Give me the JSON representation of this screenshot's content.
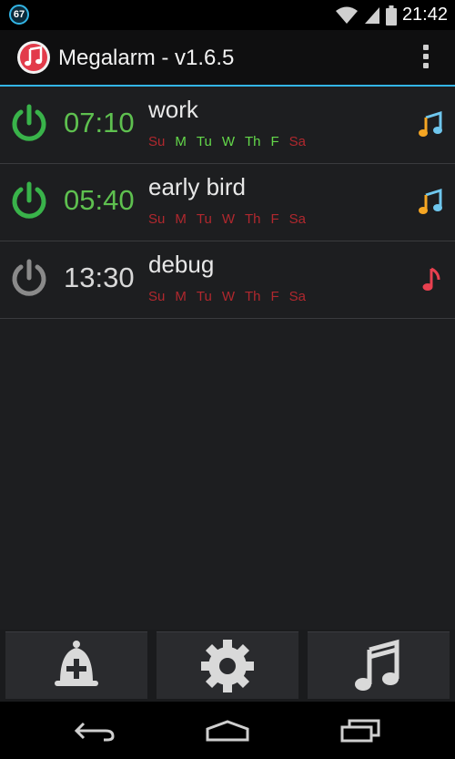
{
  "status_bar": {
    "notification_count": "67",
    "time": "21:42",
    "icons": [
      "wifi-icon",
      "cell-signal-icon",
      "battery-icon"
    ]
  },
  "action_bar": {
    "title": "Megalarm - v1.6.5",
    "app_icon": "music-note-app-icon",
    "overflow_icon": "overflow-menu-icon"
  },
  "alarms": [
    {
      "enabled": true,
      "time": "07:10",
      "name": "work",
      "days": [
        {
          "label": "Su",
          "active": false
        },
        {
          "label": "M",
          "active": true
        },
        {
          "label": "Tu",
          "active": true
        },
        {
          "label": "W",
          "active": true
        },
        {
          "label": "Th",
          "active": true
        },
        {
          "label": "F",
          "active": true
        },
        {
          "label": "Sa",
          "active": false
        }
      ],
      "sound_icon": "music-note-multicolor-icon"
    },
    {
      "enabled": true,
      "time": "05:40",
      "name": "early bird",
      "days": [
        {
          "label": "Su",
          "active": false
        },
        {
          "label": "M",
          "active": false
        },
        {
          "label": "Tu",
          "active": false
        },
        {
          "label": "W",
          "active": false
        },
        {
          "label": "Th",
          "active": false
        },
        {
          "label": "F",
          "active": false
        },
        {
          "label": "Sa",
          "active": false
        }
      ],
      "sound_icon": "music-note-multicolor-icon"
    },
    {
      "enabled": false,
      "time": "13:30",
      "name": "debug",
      "days": [
        {
          "label": "Su",
          "active": false
        },
        {
          "label": "M",
          "active": false
        },
        {
          "label": "Tu",
          "active": false
        },
        {
          "label": "W",
          "active": false
        },
        {
          "label": "Th",
          "active": false
        },
        {
          "label": "F",
          "active": false
        },
        {
          "label": "Sa",
          "active": false
        }
      ],
      "sound_icon": "music-note-red-icon"
    }
  ],
  "toolbar": {
    "buttons": [
      "add-alarm-bell-icon",
      "settings-gear-icon",
      "music-icon"
    ]
  },
  "nav_bar": {
    "buttons": [
      "back-icon",
      "home-icon",
      "recents-icon"
    ]
  },
  "colors": {
    "accent": "#33b5e5",
    "enabled_green": "#5ec04f",
    "day_active": "#64d84a",
    "day_inactive": "#b0282e"
  }
}
